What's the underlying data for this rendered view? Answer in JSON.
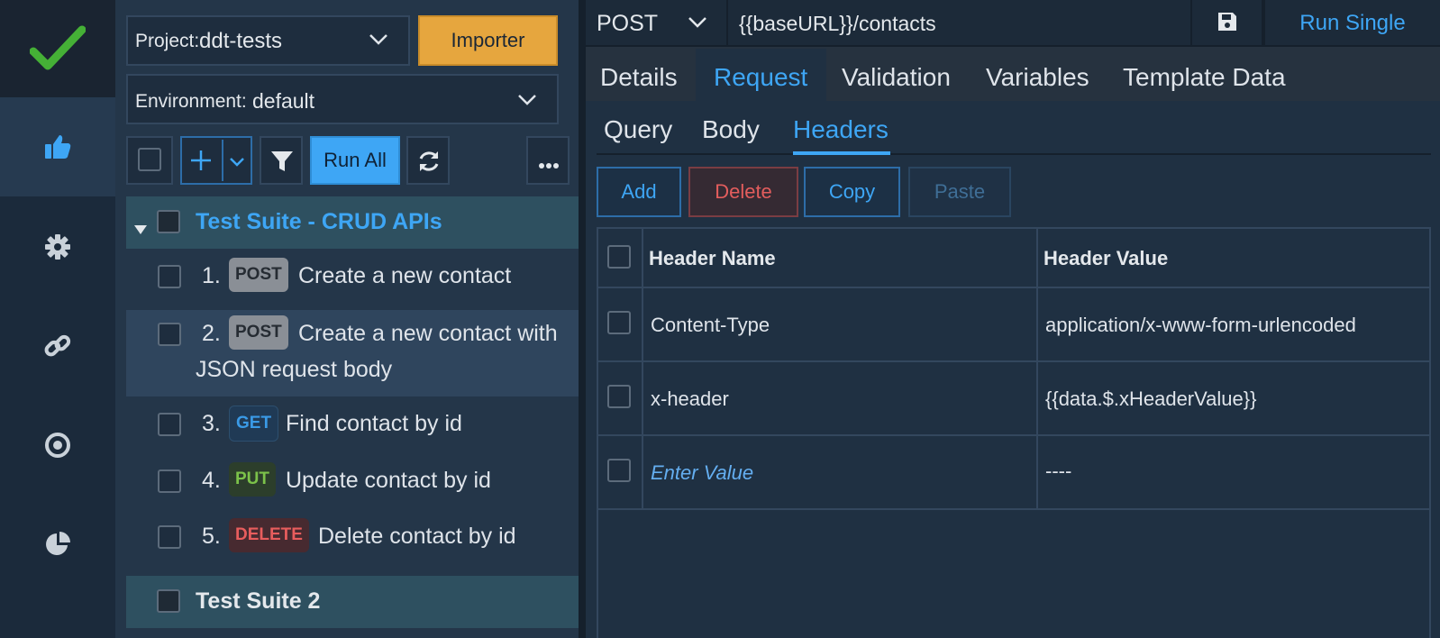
{
  "nav": {
    "icons": [
      "check-logo-icon",
      "thumbs-up-icon",
      "gear-icon",
      "link-icon",
      "target-icon",
      "pie-chart-icon"
    ]
  },
  "left": {
    "project_label": "Project:",
    "project_value": "ddt-tests",
    "importer_label": "Importer",
    "environment_label": "Environment:",
    "environment_value": "default",
    "run_all_label": "Run All",
    "suites": [
      {
        "name": "Test Suite - CRUD APIs",
        "tests": [
          {
            "num": "1.",
            "method": "POST",
            "name": "Create a new contact"
          },
          {
            "num": "2.",
            "method": "POST",
            "name": "Create a new contact with",
            "name2": "JSON request body"
          },
          {
            "num": "3.",
            "method": "GET",
            "name": "Find contact by id"
          },
          {
            "num": "4.",
            "method": "PUT",
            "name": "Update contact by id"
          },
          {
            "num": "5.",
            "method": "DELETE",
            "name": "Delete contact by id"
          }
        ]
      },
      {
        "name": "Test Suite 2"
      }
    ]
  },
  "request": {
    "method": "POST",
    "url": "{{baseURL}}/contacts",
    "run_single_label": "Run Single",
    "tabs": [
      "Details",
      "Request",
      "Validation",
      "Variables",
      "Template Data"
    ],
    "subtabs": [
      "Query",
      "Body",
      "Headers"
    ],
    "actions": [
      "Add",
      "Delete",
      "Copy",
      "Paste"
    ],
    "columns": [
      "Header Name",
      "Header Value"
    ],
    "rows": [
      {
        "name": "Content-Type",
        "value": "application/x-www-form-urlencoded"
      },
      {
        "name": "x-header",
        "value": "{{data.$.xHeaderValue}}"
      },
      {
        "name": "Enter Value",
        "value": "----"
      }
    ]
  },
  "colors": {
    "accent": "#3ea6f5",
    "orange": "#e6a63e",
    "danger": "#e35d5d"
  }
}
